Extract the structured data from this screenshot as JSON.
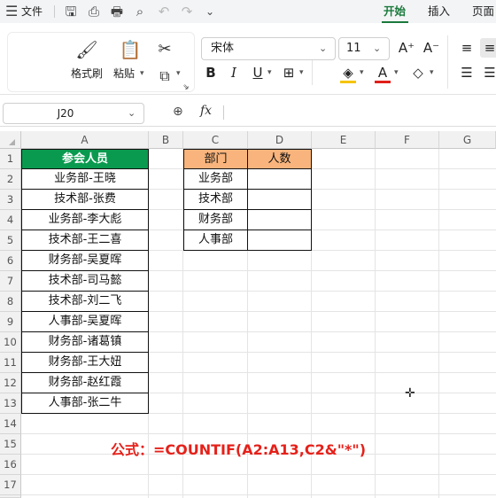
{
  "menu_bar": {
    "file_label": "文件",
    "tabs": [
      "开始",
      "插入",
      "页面"
    ],
    "active_tab": "开始"
  },
  "ribbon": {
    "format_painter_label": "格式刷",
    "paste_label": "粘贴",
    "font_name": "宋体",
    "font_size": "11"
  },
  "formula_bar": {
    "name_box": "J20",
    "fx_label": "fx",
    "formula_value": ""
  },
  "columns": [
    "A",
    "B",
    "C",
    "D",
    "E",
    "F",
    "G"
  ],
  "rows": [
    "1",
    "2",
    "3",
    "4",
    "5",
    "6",
    "7",
    "8",
    "9",
    "10",
    "11",
    "12",
    "13",
    "14",
    "15",
    "16",
    "17",
    "18"
  ],
  "table_a": {
    "header": "参会人员",
    "items": [
      "业务部-王晓",
      "技术部-张费",
      "业务部-李大彪",
      "技术部-王二喜",
      "财务部-吴夏晖",
      "技术部-司马懿",
      "技术部-刘二飞",
      "人事部-吴夏晖",
      "财务部-诸葛镇",
      "财务部-王大妞",
      "财务部-赵红霞",
      "人事部-张二牛"
    ]
  },
  "table_cd": {
    "header_c": "部门",
    "header_d": "人数",
    "departments": [
      "业务部",
      "技术部",
      "财务部",
      "人事部"
    ],
    "counts": [
      "",
      "",
      "",
      ""
    ]
  },
  "annotation": "公式：=COUNTIF(A2:A13,C2&\"*\")",
  "colors": {
    "accent_green": "#0a9a4f",
    "header_orange": "#f8b47c",
    "annotation_red": "#e5211a",
    "active_tab_green": "#1a7a3c"
  }
}
